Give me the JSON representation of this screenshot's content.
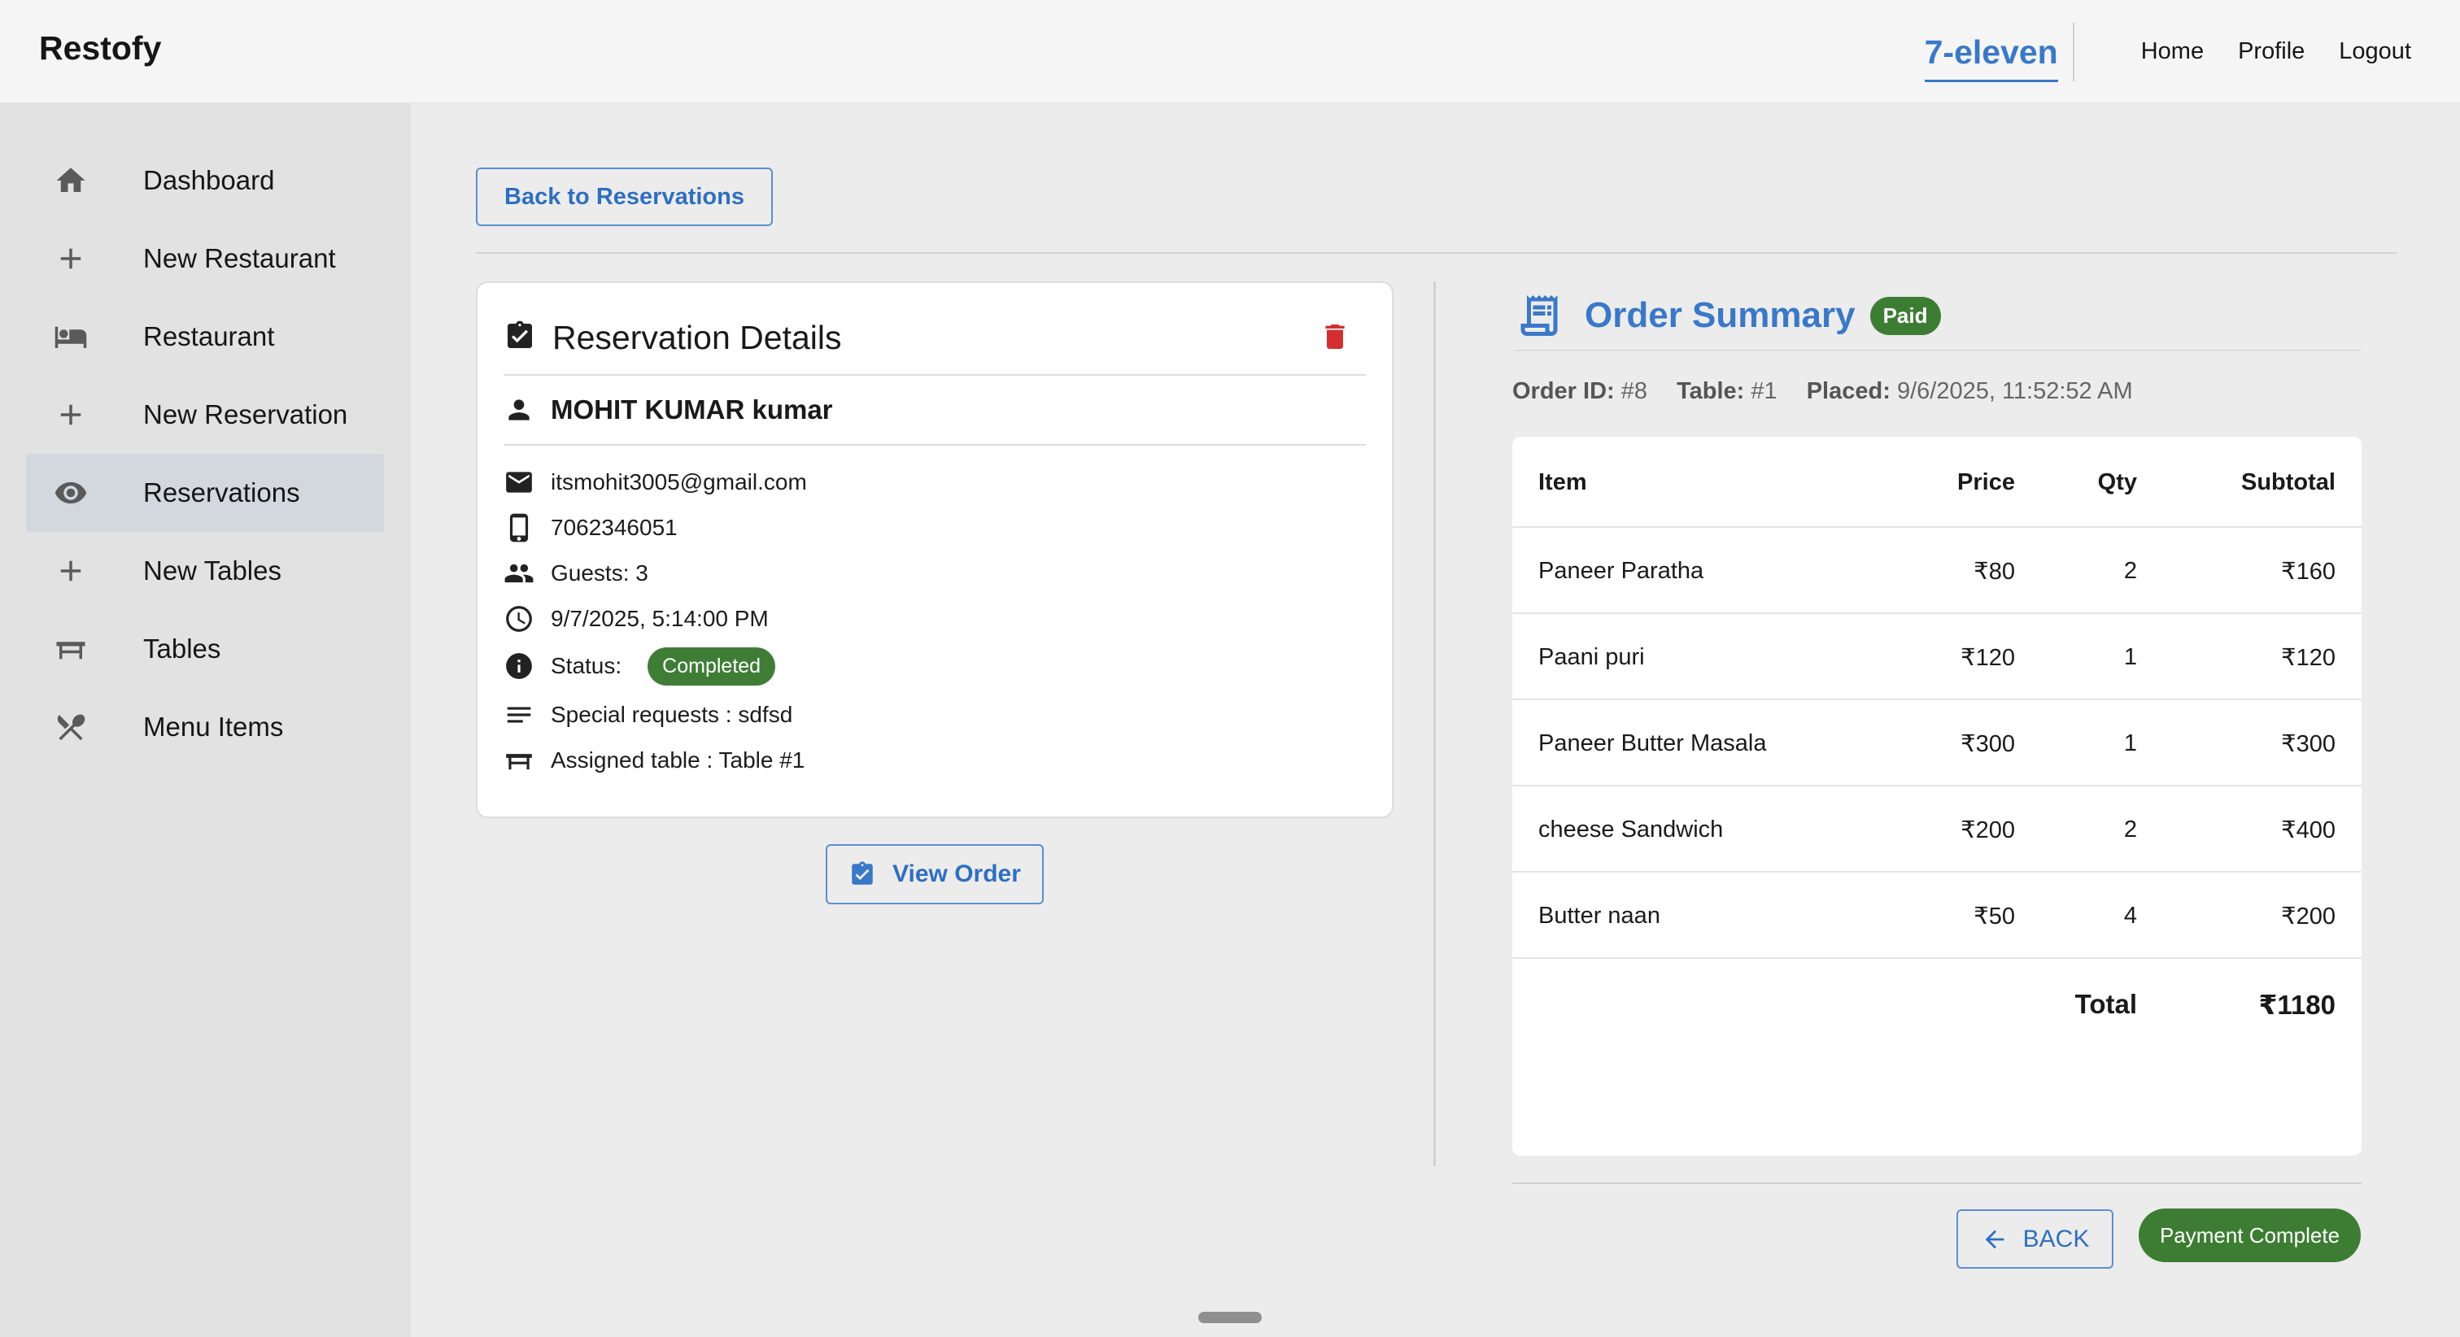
{
  "app": {
    "brand": "Restofy"
  },
  "header": {
    "restaurant_name": "7-eleven",
    "nav": {
      "home": "Home",
      "profile": "Profile",
      "logout": "Logout"
    }
  },
  "sidebar": {
    "items": [
      {
        "label": "Dashboard",
        "icon": "home-icon"
      },
      {
        "label": "New Restaurant",
        "icon": "plus-icon"
      },
      {
        "label": "Restaurant",
        "icon": "bed-icon"
      },
      {
        "label": "New Reservation",
        "icon": "plus-icon"
      },
      {
        "label": "Reservations",
        "icon": "eye-icon",
        "active": true
      },
      {
        "label": "New Tables",
        "icon": "plus-icon"
      },
      {
        "label": "Tables",
        "icon": "table-icon"
      },
      {
        "label": "Menu Items",
        "icon": "utensils-icon"
      }
    ]
  },
  "main": {
    "back_to_reservations": "Back to Reservations",
    "reservation": {
      "title": "Reservation Details",
      "name": "MOHIT KUMAR kumar",
      "email": "itsmohit3005@gmail.com",
      "phone": "7062346051",
      "guests": "Guests: 3",
      "datetime": "9/7/2025, 5:14:00 PM",
      "status_label": "Status:",
      "status": "Completed",
      "special_requests": "Special requests : sdfsd",
      "assigned_table": "Assigned table : Table #1"
    },
    "view_order": "View Order",
    "order": {
      "title": "Order Summary",
      "payment_badge": "Paid",
      "order_id_label": "Order ID:",
      "order_id": "#8",
      "table_label": "Table:",
      "table": "#1",
      "placed_label": "Placed:",
      "placed": "9/6/2025, 11:52:52 AM",
      "columns": {
        "item": "Item",
        "price": "Price",
        "qty": "Qty",
        "subtotal": "Subtotal"
      },
      "rows": [
        {
          "item": "Paneer Paratha",
          "price": "₹80",
          "qty": "2",
          "subtotal": "₹160"
        },
        {
          "item": "Paani puri",
          "price": "₹120",
          "qty": "1",
          "subtotal": "₹120"
        },
        {
          "item": "Paneer Butter Masala",
          "price": "₹300",
          "qty": "1",
          "subtotal": "₹300"
        },
        {
          "item": "cheese Sandwich",
          "price": "₹200",
          "qty": "2",
          "subtotal": "₹400"
        },
        {
          "item": "Butter naan",
          "price": "₹50",
          "qty": "4",
          "subtotal": "₹200"
        }
      ],
      "total_label": "Total",
      "total": "₹1180",
      "back": "BACK",
      "payment_complete": "Payment Complete"
    }
  },
  "colors": {
    "accent": "#3a78c8",
    "success": "#3d7d33",
    "danger": "#d32f2f"
  }
}
